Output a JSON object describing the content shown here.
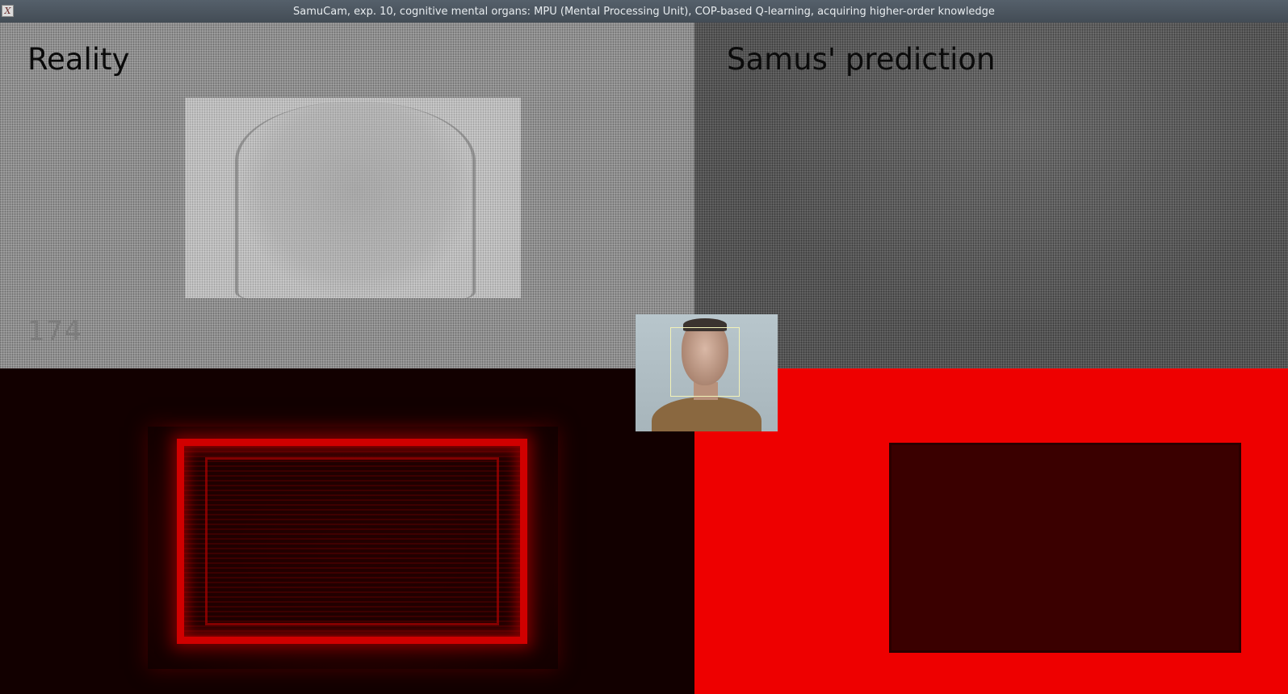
{
  "window": {
    "title": "SamuCam, exp. 10, cognitive mental organs: MPU (Mental Processing Unit), COP-based Q-learning, acquiring higher-order knowledge",
    "icon": "x-app-icon",
    "icon_glyph": "X"
  },
  "panels": {
    "reality": {
      "label": "Reality",
      "frame_counter": "174"
    },
    "prediction": {
      "label": "Samus' prediction"
    }
  },
  "colors": {
    "heatmap_red": "#ee0000",
    "heatmap_dark": "#120000"
  }
}
